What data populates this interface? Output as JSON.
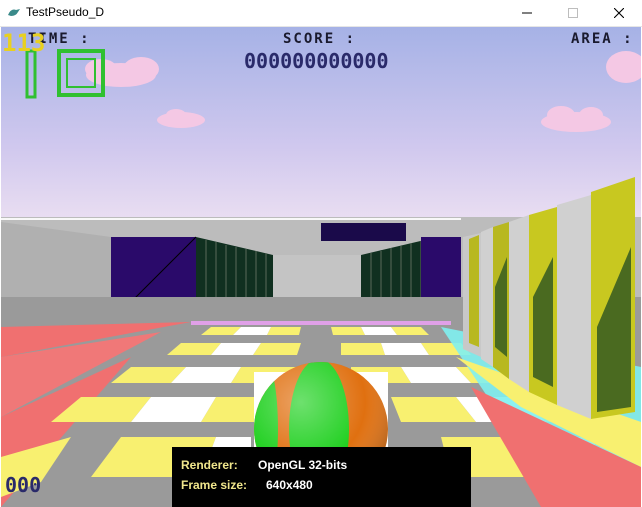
{
  "window": {
    "title": "TestPseudo_D",
    "app_icon": "app-icon",
    "controls": [
      "minimize-icon",
      "maximize-icon",
      "close-icon"
    ]
  },
  "hud": {
    "time_label": "TIME :",
    "time_value": "113",
    "score_label": "SCORE :",
    "score_value": "000000000000",
    "area_label": "AREA :",
    "bottom_counter": "000"
  },
  "info_panel": {
    "renderer_label": "Renderer:",
    "renderer_value": "OpenGL 32-bits",
    "frame_size_label": "Frame size:",
    "frame_size_value": "640x480"
  },
  "colors": {
    "sky_top": "#a8b4e8",
    "sky_bottom": "#e8d8f0",
    "wall_gray": "#b4b4b4",
    "tile_yellow": "#f8f070",
    "tile_gray": "#888888",
    "tile_red": "#f07070",
    "ball_green": "#20d020",
    "ball_orange": "#e07010",
    "hud_yellow": "#e8d020",
    "hud_green": "#30c030"
  }
}
